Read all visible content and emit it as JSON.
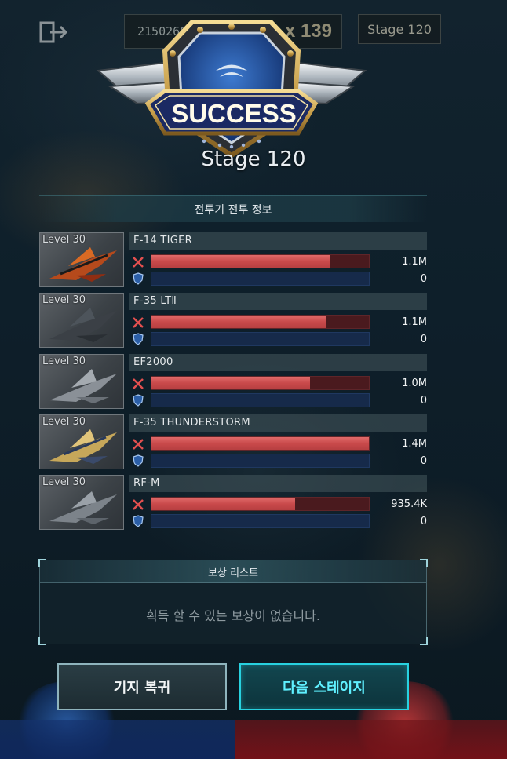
{
  "top_bar": {
    "score_id": "2150266B",
    "multiplier": "x 139",
    "stage_tag": "Stage 120"
  },
  "result": {
    "banner": "SUCCESS",
    "stage_title": "Stage 120"
  },
  "battle_info": {
    "header": "전투기 전투 정보",
    "fighters": [
      {
        "level": "Level 30",
        "name": "F-14 TIGER",
        "attack": "1.1M",
        "attack_fraction": 0.82,
        "defense": "0",
        "defense_fraction": 0,
        "jet": "tiger-jet-icon"
      },
      {
        "level": "Level 30",
        "name": "F-35 LTⅡ",
        "attack": "1.1M",
        "attack_fraction": 0.8,
        "defense": "0",
        "defense_fraction": 0,
        "jet": "f35-jet-icon"
      },
      {
        "level": "Level 30",
        "name": "EF2000",
        "attack": "1.0M",
        "attack_fraction": 0.73,
        "defense": "0",
        "defense_fraction": 0,
        "jet": "ef2000-jet-icon"
      },
      {
        "level": "Level 30",
        "name": "F-35 THUNDERSTORM",
        "attack": "1.4M",
        "attack_fraction": 1.0,
        "defense": "0",
        "defense_fraction": 0,
        "jet": "thunderstorm-jet-icon"
      },
      {
        "level": "Level 30",
        "name": "RF-M",
        "attack": "935.4K",
        "attack_fraction": 0.66,
        "defense": "0",
        "defense_fraction": 0,
        "jet": "rfm-jet-icon"
      }
    ]
  },
  "rewards": {
    "header": "보상 리스트",
    "empty_message": "획득 할 수 있는 보상이 없습니다."
  },
  "buttons": {
    "return_base": "기지 복귀",
    "next_stage": "다음 스테이지"
  },
  "colors": {
    "attack_bar": "#c94a4b",
    "defense_bar": "#162a4a",
    "next_button_accent": "#28d2e0",
    "badge_blue": "#1e4a9a",
    "badge_gold": "#d7b25a"
  }
}
